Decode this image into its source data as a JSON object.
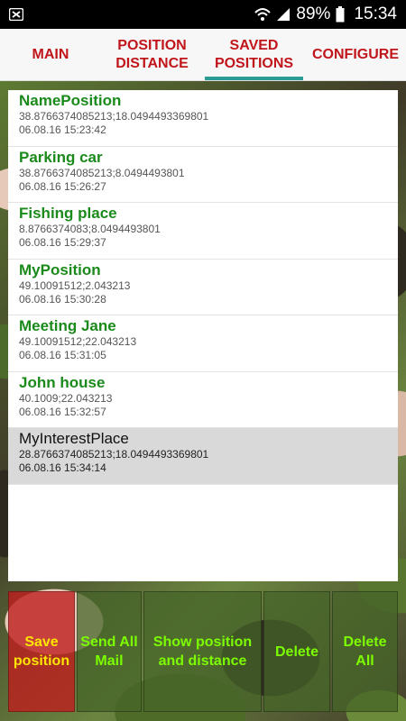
{
  "status_bar": {
    "time": "15:34",
    "battery": "89%",
    "icons": [
      "notification-icon",
      "wifi-icon",
      "signal-icon",
      "battery-icon"
    ]
  },
  "tabs": [
    {
      "label_line1": "MAIN",
      "label_line2": "",
      "active": false
    },
    {
      "label_line1": "POSITION",
      "label_line2": "DISTANCE",
      "active": false
    },
    {
      "label_line1": "SAVED",
      "label_line2": "POSITIONS",
      "active": true
    },
    {
      "label_line1": "CONFIGURE",
      "label_line2": "",
      "active": false
    }
  ],
  "positions": [
    {
      "name": "NamePosition",
      "coords": "38.8766374085213;18.0494493369801",
      "date": "06.08.16 15:23:42"
    },
    {
      "name": "Parking car",
      "coords": "38.8766374085213;8.0494493801",
      "date": "06.08.16 15:26:27"
    },
    {
      "name": "Fishing place",
      "coords": "8.8766374083;8.0494493801",
      "date": "06.08.16 15:29:37"
    },
    {
      "name": "MyPosition",
      "coords": "49.10091512;2.043213",
      "date": "06.08.16 15:30:28"
    },
    {
      "name": "Meeting Jane",
      "coords": "49.10091512;22.043213",
      "date": "06.08.16 15:31:05"
    },
    {
      "name": "John house",
      "coords": "40.1009;22.043213",
      "date": "06.08.16 15:32:57"
    },
    {
      "name": "MyInterestPlace",
      "coords": "28.8766374085213;18.0494493369801",
      "date": "06.08.16 15:34:14",
      "selected": true
    }
  ],
  "buttons": {
    "save_line1": "Save",
    "save_line2": "position",
    "mail_line1": "Send All",
    "mail_line2": "Mail",
    "show_line1": "Show position",
    "show_line2": "and distance",
    "delete": "Delete",
    "delete_all_line1": "Delete",
    "delete_all_line2": "All"
  },
  "colors": {
    "tab_text": "#c0161b",
    "tab_indicator": "#2b9c94",
    "item_name": "#1a8a1a",
    "button_text": "#7cfc00"
  }
}
